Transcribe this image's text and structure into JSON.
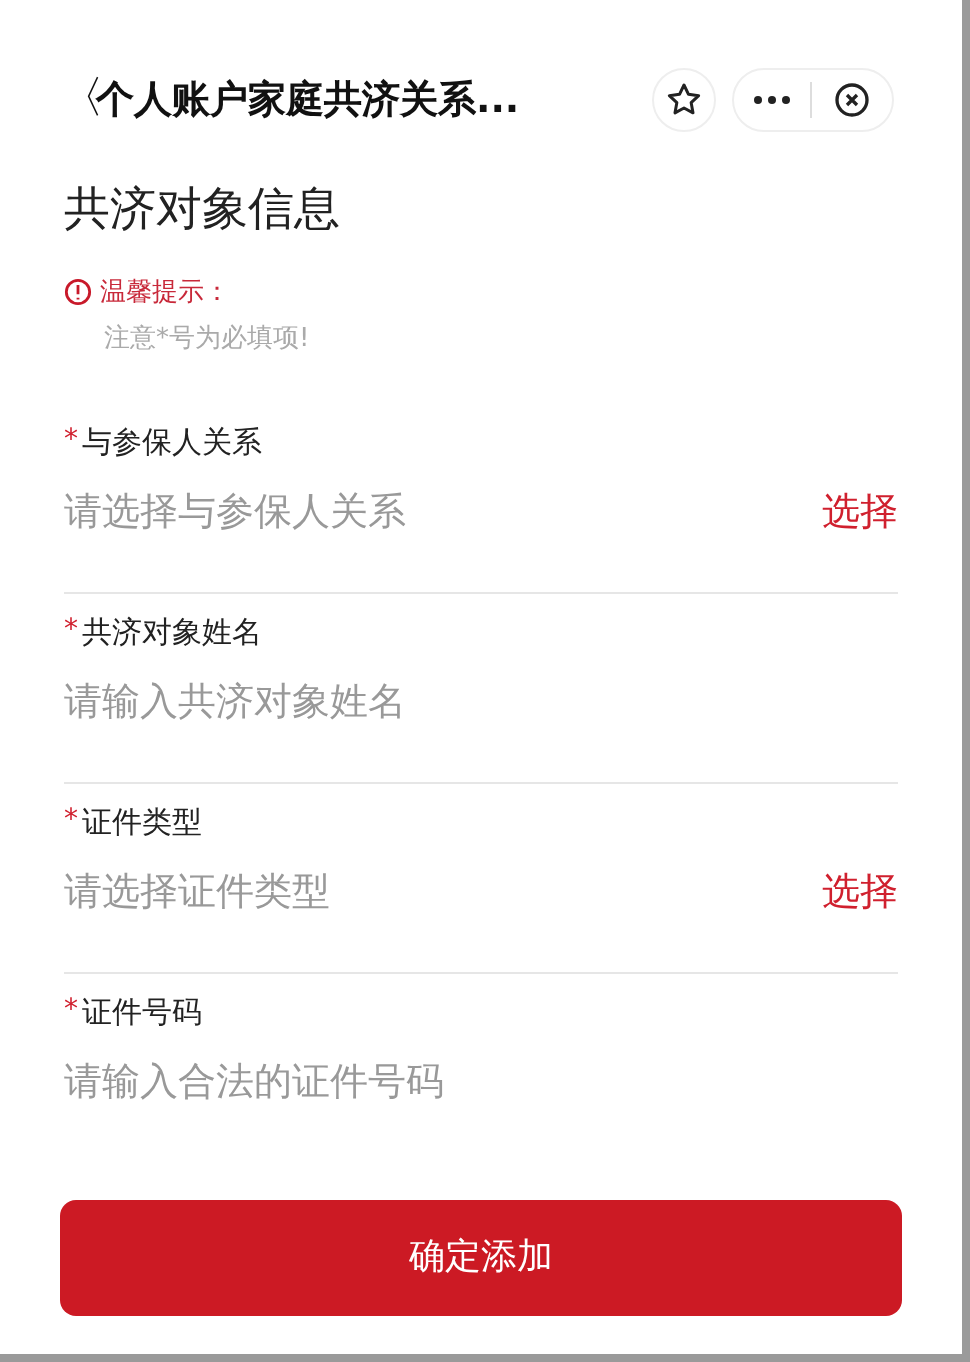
{
  "nav": {
    "back": "〈",
    "title": "个人账户家庭共济关系..."
  },
  "heading": "共济对象信息",
  "notice": {
    "title": "温馨提示：",
    "text": "注意*号为必填项!"
  },
  "fields": [
    {
      "kind": "select",
      "mark": "*",
      "label": "与参保人关系",
      "placeholder": "请选择与参保人关系",
      "action": "选择"
    },
    {
      "kind": "input",
      "mark": "*",
      "label": "共济对象姓名",
      "placeholder": "请输入共济对象姓名"
    },
    {
      "kind": "select",
      "mark": "*",
      "label": "证件类型",
      "placeholder": "请选择证件类型",
      "action": "选择"
    },
    {
      "kind": "input",
      "mark": "*",
      "label": "证件号码",
      "placeholder": "请输入合法的证件号码"
    }
  ],
  "submit": "确定添加"
}
